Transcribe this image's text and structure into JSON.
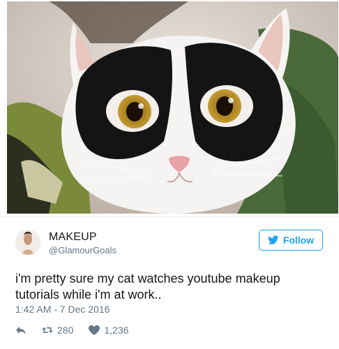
{
  "photo": {
    "subject": "cat-face-icon"
  },
  "tweet": {
    "display_name": "MAKEUP",
    "handle": "@GlamourGoals",
    "follow_label": "Follow",
    "text": "i'm pretty sure my cat watches youtube makeup tutorials while i'm at work..",
    "timestamp": "1:42 AM - 7 Dec 2016",
    "retweets": "280",
    "likes": "1,236"
  },
  "colors": {
    "accent": "#1da1f2",
    "secondary_text": "#657786",
    "primary_text": "#14171a"
  }
}
